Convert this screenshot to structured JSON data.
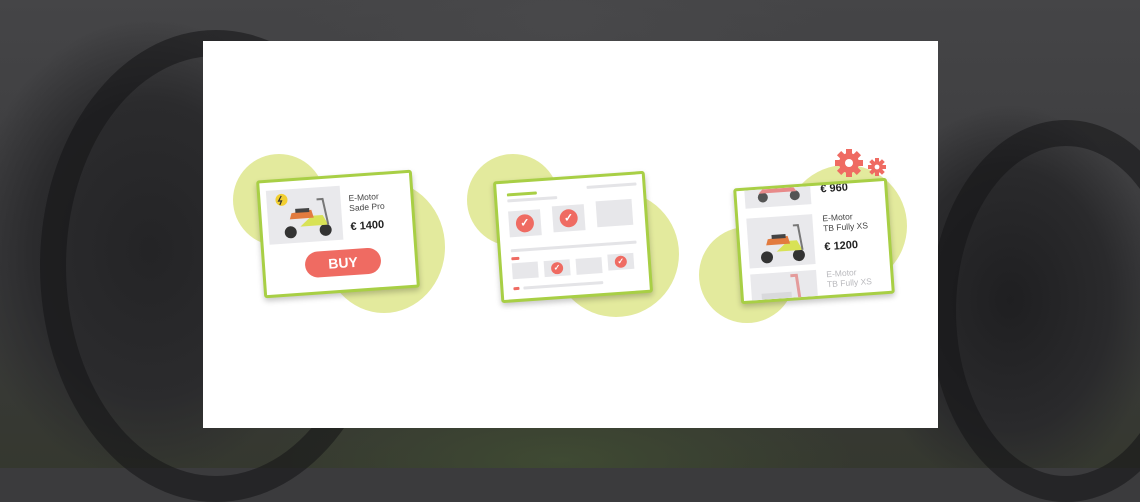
{
  "illustration_1": {
    "product_name": "E-Motor\nSade  Pro",
    "price": "€ 1400",
    "buy_label": "BUY"
  },
  "illustration_3": {
    "top_price": "€ 960",
    "product_name": "E-Motor\nTB Fully XS",
    "price": "€ 1200",
    "faded_name": "E-Motor\nTB Fully XS"
  },
  "colors": {
    "accent_green": "#a8cf45",
    "blob_yellow": "#e3ea9d",
    "red": "#ef6b62"
  }
}
